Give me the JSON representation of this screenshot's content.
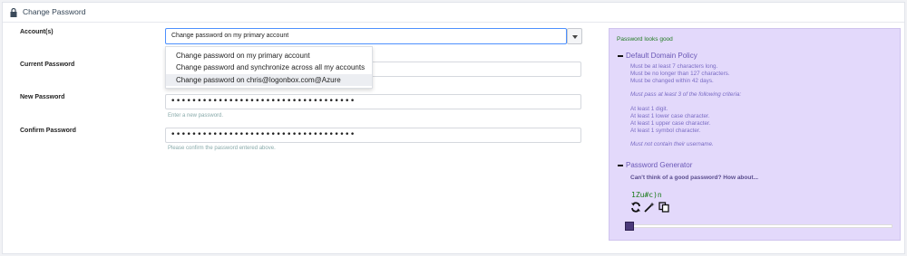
{
  "header": {
    "title": "Change Password"
  },
  "labels": {
    "account": "Account(s)",
    "current": "Current Password",
    "new": "New Password",
    "confirm": "Confirm Password"
  },
  "account_select": {
    "value": "Change password on my primary account"
  },
  "dropdown": {
    "options": [
      "Change password on my primary account",
      "Change password and synchronize across all my accounts",
      "Change password on chris@logonbox.com@Azure"
    ]
  },
  "new_password": {
    "masked": "•••••••••••••••••••••••••••••••••••",
    "hint": "Enter a new password."
  },
  "confirm_password": {
    "masked": "•••••••••••••••••••••••••••••••••••",
    "hint": "Please confirm the password entered above."
  },
  "side": {
    "status": "Password looks good",
    "policy_title": "Default Domain Policy",
    "policy_lines": [
      "Must be at least 7 characters long.",
      "Must be no longer than 127 characters.",
      "Must be changed within 42 days."
    ],
    "criteria_intro": "Must pass at least 3 of the following criteria:",
    "criteria": [
      "At least 1 digit.",
      "At least 1 lower case character.",
      "At least 1 upper case character.",
      "At least 1 symbol character."
    ],
    "username_rule": "Must not contain their username.",
    "generator_title": "Password Generator",
    "generator_question": "Can't think of a good password? How about...",
    "generated_password": "1Zu#c)n",
    "length_fraction": 0.0
  },
  "colors": {
    "accent": "#4d90fe",
    "side_bg": "#e3d9fb",
    "good": "#1f7a1f",
    "policy_text": "#7a6cc4"
  }
}
